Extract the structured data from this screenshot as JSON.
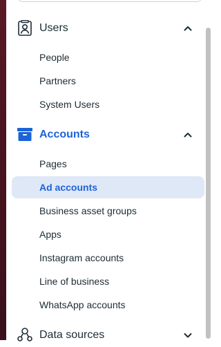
{
  "sections": [
    {
      "label": "Users",
      "expanded": true,
      "icon": "users-icon",
      "items": [
        {
          "label": "People"
        },
        {
          "label": "Partners"
        },
        {
          "label": "System Users"
        }
      ]
    },
    {
      "label": "Accounts",
      "expanded": true,
      "active": true,
      "icon": "briefcase-icon",
      "items": [
        {
          "label": "Pages"
        },
        {
          "label": "Ad accounts",
          "selected": true
        },
        {
          "label": "Business asset groups"
        },
        {
          "label": "Apps"
        },
        {
          "label": "Instagram accounts"
        },
        {
          "label": "Line of business"
        },
        {
          "label": "WhatsApp accounts"
        }
      ]
    },
    {
      "label": "Data sources",
      "expanded": false,
      "icon": "data-sources-icon"
    }
  ],
  "colors": {
    "accent": "#1b63d8",
    "selected_bg": "#dfe8f7",
    "text": "#1c2b33"
  }
}
